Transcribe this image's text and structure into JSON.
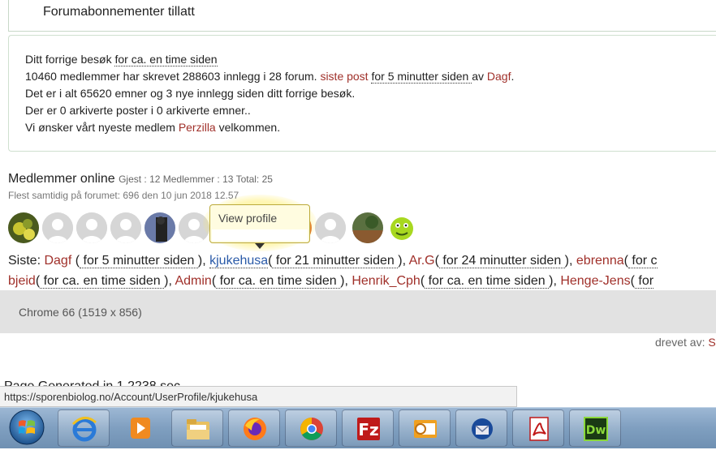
{
  "header": {
    "title": "Forumabonnementer tillatt"
  },
  "stats": {
    "last_visit_prefix": "Ditt forrige besøk",
    "last_visit_time": " for ca. en time siden ",
    "line2_prefix": "10460 medlemmer har skrevet 288603 innlegg i 28 forum.",
    "last_post_link": "siste post",
    "last_post_time": " for 5 minutter siden ",
    "by_word": "av",
    "last_post_author": "Dagf",
    "line3": "Det er i alt 65620 emner og 3 nye innlegg siden ditt forrige besøk.",
    "line4": "Der er 0 arkiverte poster i 0 arkiverte emner..",
    "line5_prefix": "Vi ønsker vårt nyeste medlem",
    "newest_member": "Perzilla",
    "line5_suffix": "velkommen."
  },
  "online": {
    "title": "Medlemmer online",
    "counts": "Gjest : 12 Medlemmer : 13 Total: 25",
    "record": "Flest samtidig på forumet: 696 den 10 jun 2018 12.57",
    "tooltip": "View profile"
  },
  "recent": {
    "label": "Siste:",
    "users": [
      {
        "name": "Dagf",
        "time": " for 5 minutter siden ",
        "sep": ", "
      },
      {
        "name": "kjukehusa",
        "time": " for 21 minutter siden ",
        "sep": ", "
      },
      {
        "name": "Ar.G",
        "time": " for 24 minutter siden ",
        "sep": ", "
      },
      {
        "name": "ebrenna",
        "time": " for c",
        "sep": ""
      }
    ],
    "users2": [
      {
        "name": "bjeid",
        "time": " for ca. en time siden ",
        "sep": ", "
      },
      {
        "name": "Admin",
        "time": " for ca. en time siden ",
        "sep": ", "
      },
      {
        "name": "Henrik_Cph",
        "time": " for ca. en time siden ",
        "sep": ", "
      },
      {
        "name": "Henge-Jens",
        "time": " for",
        "sep": ""
      }
    ]
  },
  "browser_info": "Chrome 66 (1519 x 856)",
  "powered_by": {
    "label": "drevet av:",
    "name": "S"
  },
  "page_generated": "Page Generated in 1.2238 sec",
  "status_url": "https://sporenbiolog.no/Account/UserProfile/kjukehusa",
  "taskbar": {
    "apps": [
      "start-orb",
      "internet-explorer",
      "media-player",
      "file-explorer",
      "firefox",
      "chrome",
      "filezilla",
      "outlook",
      "thunderbird",
      "acrobat",
      "dreamweaver"
    ],
    "dreamweaver_label": "Dw",
    "filezilla_label": "Fz"
  },
  "colors": {
    "link_red": "#a0302a",
    "link_blue": "#2a5aa8",
    "tooltip_bg": "#fffce0"
  }
}
